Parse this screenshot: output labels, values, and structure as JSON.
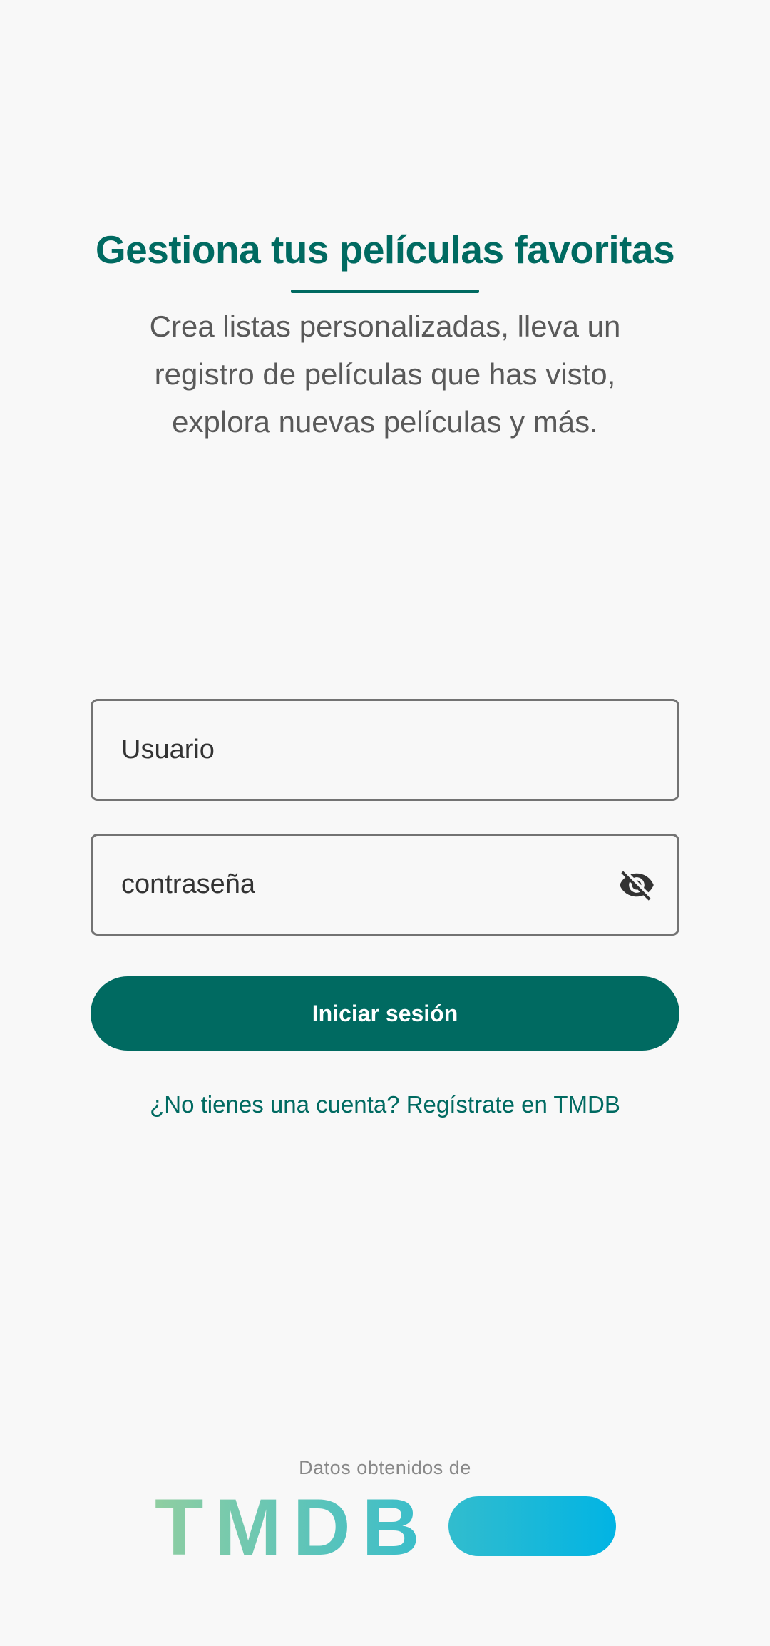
{
  "header": {
    "title": "Gestiona tus películas favoritas",
    "subtitle": "Crea listas personalizadas, lleva un registro de películas que has visto, explora nuevas películas y más."
  },
  "form": {
    "username_placeholder": "Usuario",
    "password_placeholder": "contraseña",
    "password_visibility_icon": "eye-off-icon",
    "login_label": "Iniciar sesión",
    "signup_link": "¿No tienes una cuenta? Regístrate en TMDB"
  },
  "footer": {
    "attribution": "Datos obtenidos de",
    "logo_text": "TMDB"
  },
  "colors": {
    "primary": "#006a61",
    "background": "#f8f8f8",
    "text_secondary": "#595959",
    "logo_gradient_start": "#90cea1",
    "logo_gradient_end": "#01b4e4"
  }
}
